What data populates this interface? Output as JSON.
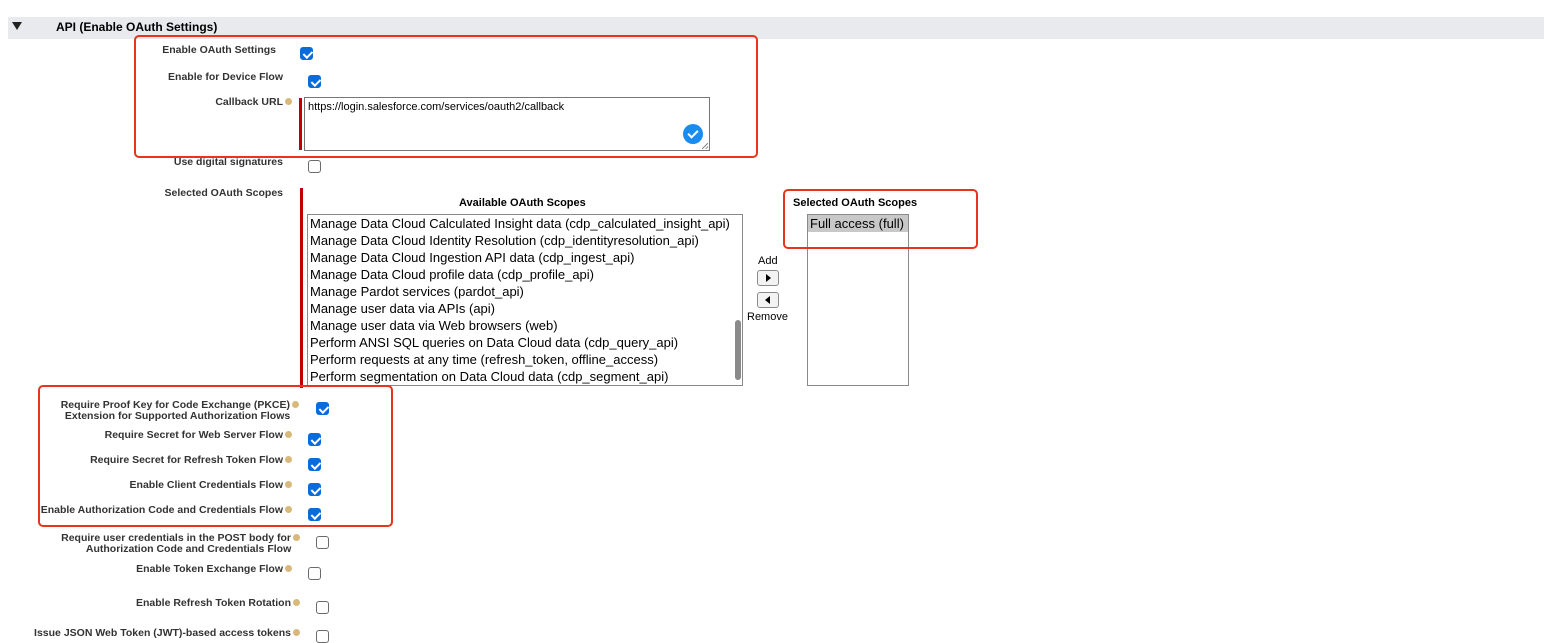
{
  "section": {
    "title": "API (Enable OAuth Settings)"
  },
  "fields": {
    "enable_oauth": {
      "label": "Enable OAuth Settings",
      "checked": true
    },
    "enable_device_flow": {
      "label": "Enable for Device Flow",
      "checked": true
    },
    "callback_url": {
      "label": "Callback URL",
      "value": "https://login.salesforce.com/services/oauth2/callback"
    },
    "digital_signatures": {
      "label": "Use digital signatures",
      "checked": false
    },
    "selected_scopes": {
      "label": "Selected OAuth Scopes"
    },
    "pkce": {
      "label_line1": "Require Proof Key for Code Exchange (PKCE)",
      "label_line2": "Extension for Supported Authorization Flows",
      "checked": true
    },
    "secret_web_server": {
      "label": "Require Secret for Web Server Flow",
      "checked": true
    },
    "secret_refresh": {
      "label": "Require Secret for Refresh Token Flow",
      "checked": true
    },
    "client_credentials": {
      "label": "Enable Client Credentials Flow",
      "checked": true
    },
    "auth_code_credentials": {
      "label": "Enable Authorization Code and Credentials Flow",
      "checked": true
    },
    "post_body_creds": {
      "label_line1": "Require user credentials in the POST body for",
      "label_line2": "Authorization Code and Credentials Flow",
      "checked": false
    },
    "token_exchange": {
      "label": "Enable Token Exchange Flow",
      "checked": false
    },
    "refresh_rotation": {
      "label": "Enable Refresh Token Rotation",
      "checked": false
    },
    "jwt_tokens": {
      "label": "Issue JSON Web Token (JWT)-based access tokens",
      "checked": false
    }
  },
  "scopes": {
    "available_title": "Available OAuth Scopes",
    "selected_title": "Selected OAuth Scopes",
    "available": [
      "Manage Data Cloud Calculated Insight data (cdp_calculated_insight_api)",
      "Manage Data Cloud Identity Resolution (cdp_identityresolution_api)",
      "Manage Data Cloud Ingestion API data (cdp_ingest_api)",
      "Manage Data Cloud profile data (cdp_profile_api)",
      "Manage Pardot services (pardot_api)",
      "Manage user data via APIs (api)",
      "Manage user data via Web browsers (web)",
      "Perform ANSI SQL queries on Data Cloud data (cdp_query_api)",
      "Perform requests at any time (refresh_token, offline_access)",
      "Perform segmentation on Data Cloud data (cdp_segment_api)"
    ],
    "selected": [
      "Full access (full)"
    ],
    "add_label": "Add",
    "remove_label": "Remove"
  },
  "colors": {
    "highlight": "#e8341c",
    "checkbox": "#0a6cdb",
    "required_bar": "#c00000",
    "header_bg": "#e8eaee"
  }
}
